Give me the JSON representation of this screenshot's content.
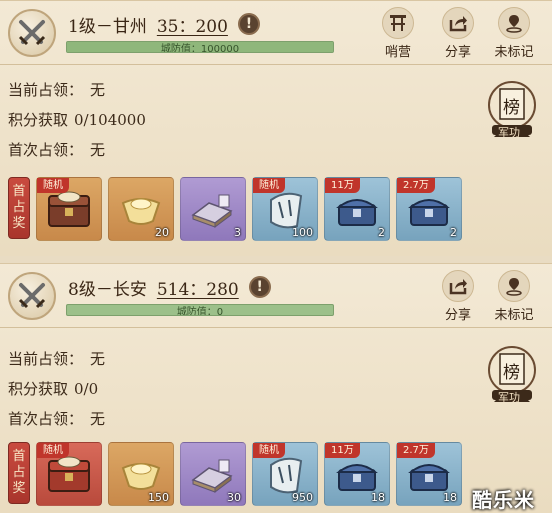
{
  "colors": {
    "parchment": "#f3e9d5",
    "defense_bar": "#9cc08a",
    "first_badge": "#c0352b",
    "quality_orange": "#dca765",
    "quality_purple": "#b09bd3",
    "quality_blue": "#9ec3d8"
  },
  "cities": [
    {
      "name": "1级－甘州",
      "troops": "35：200",
      "defense_text": "城防值：100000",
      "defense_level": 1.0,
      "actions": [
        {
          "label": "哨营",
          "icon": "outpost-icon"
        },
        {
          "label": "分享",
          "icon": "share-icon"
        },
        {
          "label": "未标记",
          "icon": "map-pin-icon"
        }
      ],
      "info": [
        {
          "label": "当前占领：",
          "value": "无"
        },
        {
          "label": "积分获取",
          "value": "0/104000"
        },
        {
          "label": "首次占领：",
          "value": "无"
        }
      ],
      "rank_badge": {
        "top": "榜",
        "bottom": "军功"
      },
      "first_reward_label": [
        "首",
        "占",
        "奖"
      ],
      "rewards": [
        {
          "icon": "chest-icon",
          "quality": "orange",
          "tag": "随机",
          "count": ""
        },
        {
          "icon": "gold-ingot-icon",
          "quality": "orange",
          "tag": "",
          "count": "20"
        },
        {
          "icon": "ore-pile-icon",
          "quality": "purple",
          "tag": "",
          "count": "3"
        },
        {
          "icon": "scroll-icon",
          "quality": "blue",
          "tag": "随机",
          "count": "100"
        },
        {
          "icon": "blue-chest-icon",
          "quality": "blue",
          "tag": "11万",
          "count": "2"
        },
        {
          "icon": "blue-chest-icon",
          "quality": "blue",
          "tag": "2.7万",
          "count": "2"
        }
      ]
    },
    {
      "name": "8级－长安",
      "troops": "514：280",
      "defense_text": "城防值：0",
      "defense_level": 0,
      "actions": [
        {
          "label": "分享",
          "icon": "share-icon"
        },
        {
          "label": "未标记",
          "icon": "map-pin-icon"
        }
      ],
      "info": [
        {
          "label": "当前占领：",
          "value": "无"
        },
        {
          "label": "积分获取",
          "value": "0/0"
        },
        {
          "label": "首次占领：",
          "value": "无"
        }
      ],
      "rank_badge": {
        "top": "榜",
        "bottom": "军功"
      },
      "first_reward_label": [
        "首",
        "占",
        "奖"
      ],
      "rewards": [
        {
          "icon": "chest-icon",
          "quality": "orange",
          "tag": "随机",
          "count": ""
        },
        {
          "icon": "gold-ingot-icon",
          "quality": "orange",
          "tag": "",
          "count": "150"
        },
        {
          "icon": "ore-pile-icon",
          "quality": "purple",
          "tag": "",
          "count": "30"
        },
        {
          "icon": "scroll-icon",
          "quality": "blue",
          "tag": "随机",
          "count": "950"
        },
        {
          "icon": "blue-chest-icon",
          "quality": "blue",
          "tag": "11万",
          "count": "18"
        },
        {
          "icon": "blue-chest-icon",
          "quality": "blue",
          "tag": "2.7万",
          "count": "18"
        }
      ]
    }
  ],
  "watermark": "酷乐米"
}
